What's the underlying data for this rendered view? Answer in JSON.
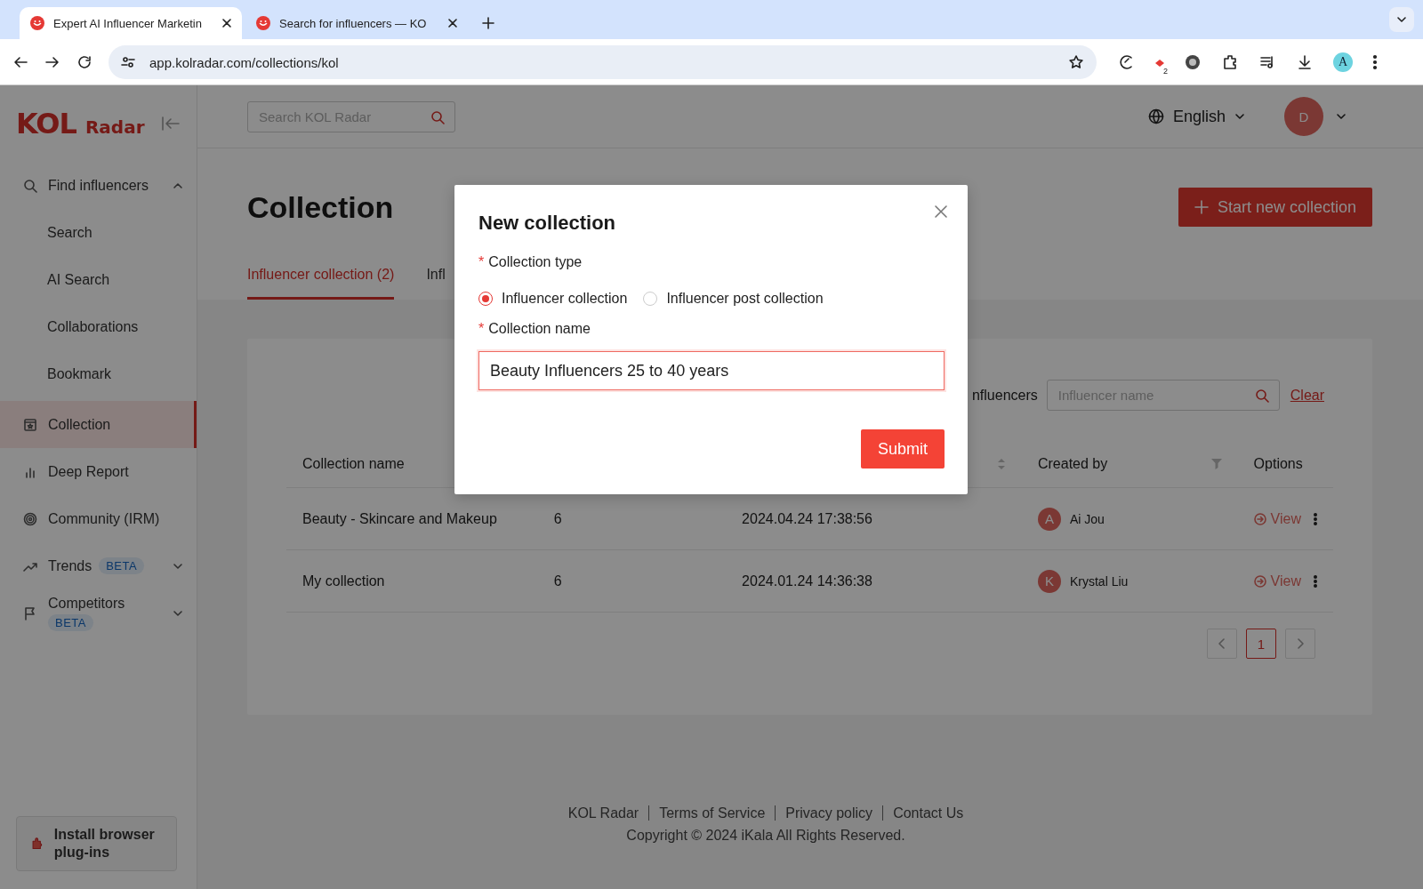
{
  "browser": {
    "tabs": [
      {
        "title": "Expert AI Influencer Marketin",
        "selected": true
      },
      {
        "title": "Search for influencers — KO",
        "selected": false
      }
    ],
    "url": "app.kolradar.com/collections/kol",
    "extension_badge": "2",
    "profile_initial": "A"
  },
  "sidebar": {
    "logo": {
      "mark": "KOL",
      "word": "Radar"
    },
    "nav": [
      {
        "kind": "group",
        "label": "Find influencers",
        "expanded": true,
        "selected": false,
        "children": [
          {
            "label": "Search",
            "selected": false
          },
          {
            "label": "AI Search",
            "selected": false
          },
          {
            "label": "Collaborations",
            "selected": false
          },
          {
            "label": "Bookmark",
            "selected": false
          }
        ]
      },
      {
        "kind": "link",
        "label": "Collection",
        "selected": true
      },
      {
        "kind": "link",
        "label": "Deep Report",
        "selected": false
      },
      {
        "kind": "link",
        "label": "Community (IRM)",
        "selected": false
      },
      {
        "kind": "group",
        "label": "Trends",
        "badge": "BETA",
        "expanded": false,
        "selected": false
      },
      {
        "kind": "group",
        "label": "Competitors",
        "badge": "BETA",
        "expanded": false,
        "selected": false
      }
    ],
    "install_button": "Install browser plug-ins"
  },
  "topbar": {
    "search": {
      "placeholder": "Search KOL Radar"
    },
    "language": "English",
    "avatar_initial": "D"
  },
  "page": {
    "title": "Collection",
    "new_button": "Start new collection",
    "tabs": [
      {
        "label": "Influencer collection (2)",
        "selected": true
      },
      {
        "label": "Infl",
        "selected": false
      }
    ],
    "filter": {
      "label": "nfluencers",
      "placeholder": "Influencer name",
      "clear": "Clear"
    },
    "table": {
      "columns": [
        {
          "label": "Collection name"
        },
        {},
        {
          "sortable": true
        },
        {
          "label": "Created by",
          "filterable": true
        },
        {
          "label": "Options"
        }
      ],
      "rows": [
        {
          "name": "Beauty - Skincare and Makeup",
          "count": "6",
          "created": "2024.04.24 17:38:56",
          "creator": {
            "initial": "A",
            "name": "Ai Jou"
          },
          "action": "View"
        },
        {
          "name": "My collection",
          "count": "6",
          "created": "2024.01.24 14:36:38",
          "creator": {
            "initial": "K",
            "name": "Krystal Liu"
          },
          "action": "View"
        }
      ]
    },
    "pagination": [
      {
        "label": "1",
        "selected": true
      }
    ]
  },
  "footer": {
    "links": [
      "KOL Radar",
      "Terms of Service",
      "Privacy policy",
      "Contact Us"
    ],
    "copyright": "Copyright © 2024 iKala All Rights Reserved."
  },
  "modal": {
    "title": "New collection",
    "type_field": {
      "required_mark": "*",
      "label": "Collection type",
      "options": [
        {
          "label": "Influencer collection",
          "selected": true
        },
        {
          "label": "Influencer post collection",
          "selected": false
        }
      ]
    },
    "name_field": {
      "required_mark": "*",
      "label": "Collection name",
      "value": "Beauty Influencers 25 to 40 years"
    },
    "submit": "Submit"
  }
}
